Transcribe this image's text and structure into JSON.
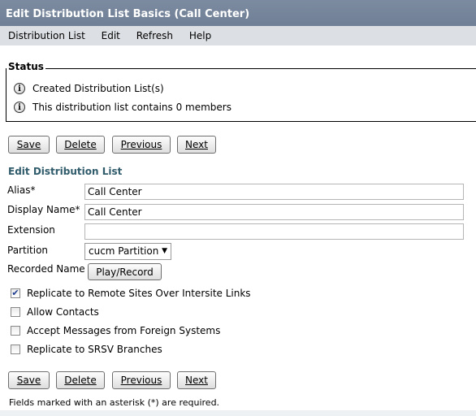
{
  "window": {
    "title": "Edit Distribution List Basics  (Call Center)"
  },
  "menu": {
    "items": [
      "Distribution List",
      "Edit",
      "Refresh",
      "Help"
    ]
  },
  "status": {
    "legend": "Status",
    "messages": [
      "Created Distribution List(s)",
      "This distribution list contains 0 members"
    ]
  },
  "buttons": {
    "save": "Save",
    "delete": "Delete",
    "previous": "Previous",
    "next": "Next",
    "play_record": "Play/Record"
  },
  "form": {
    "section_title": "Edit Distribution List",
    "alias_label": "Alias*",
    "alias_value": "Call Center",
    "display_name_label": "Display Name*",
    "display_name_value": "Call Center",
    "extension_label": "Extension",
    "extension_value": "",
    "partition_label": "Partition",
    "partition_value": "cucm Partition",
    "recorded_name_label": "Recorded Name"
  },
  "options": [
    {
      "label": "Replicate to Remote Sites Over Intersite Links",
      "checked": true
    },
    {
      "label": "Allow Contacts",
      "checked": false
    },
    {
      "label": "Accept Messages from Foreign Systems",
      "checked": false
    },
    {
      "label": "Replicate to SRSV Branches",
      "checked": false
    }
  ],
  "footer": {
    "note": "Fields marked with an asterisk (*) are required."
  }
}
